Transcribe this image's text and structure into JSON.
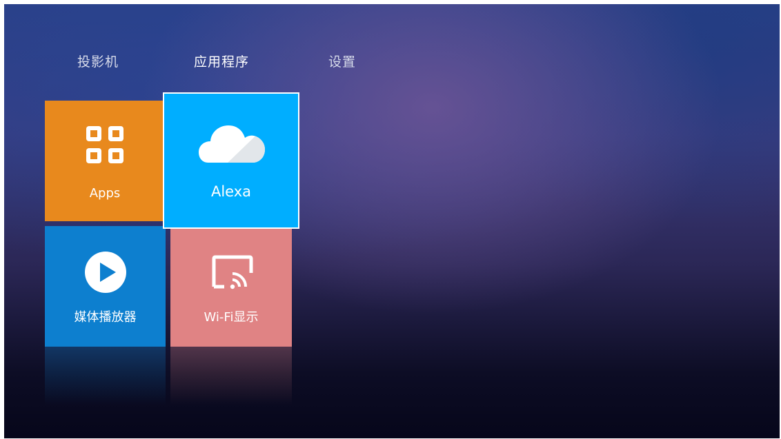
{
  "nav": {
    "tabs": [
      {
        "label": "投影机",
        "selected": false
      },
      {
        "label": "应用程序",
        "selected": true
      },
      {
        "label": "设置",
        "selected": false
      }
    ]
  },
  "tiles": {
    "apps": {
      "label": "Apps",
      "icon": "apps-grid-icon",
      "color": "#e8891d"
    },
    "alexa": {
      "label": "Alexa",
      "icon": "cloud-icon",
      "color": "#00aeff",
      "focused": true
    },
    "media": {
      "label": "媒体播放器",
      "icon": "play-icon",
      "color": "#0d7fcf"
    },
    "wifi": {
      "label": "Wi-Fi显示",
      "icon": "cast-icon",
      "color": "#e08384"
    }
  }
}
